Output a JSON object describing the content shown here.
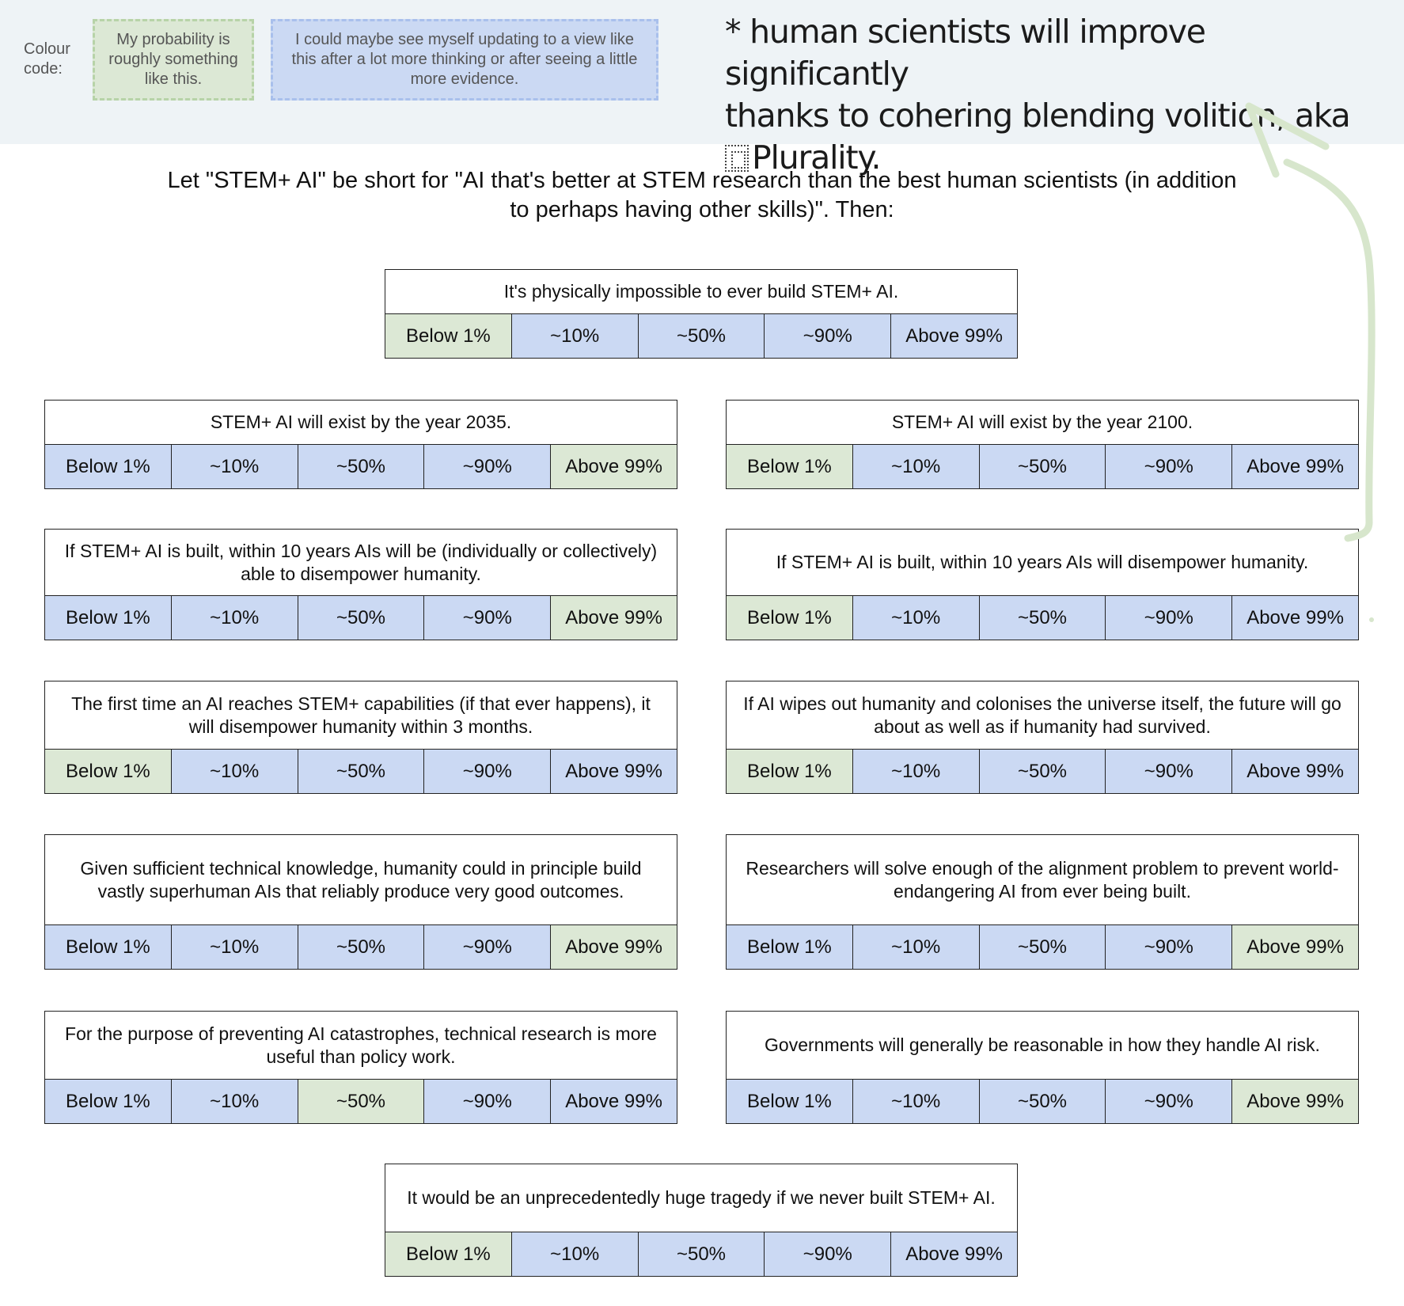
{
  "legend": {
    "label": "Colour code:",
    "green_text": "My probability is roughly something like this.",
    "blue_text": "I could maybe see myself updating to a view like this after a lot more thinking or after seeing a little more evidence.",
    "green_color": "#dce8d5",
    "blue_color": "#cbd9f3"
  },
  "annotation": {
    "line1": "* human scientists will improve significantly",
    "line2": "thanks to cohering blending volition, aka",
    "glyph": "copy-icon",
    "line3": "Plurality.",
    "arrow_color": "#d7e6cc"
  },
  "intro": "Let \"STEM+ AI\" be short for \"AI that's better at STEM research than the best human scientists (in addition to perhaps having other skills)\". Then:",
  "options": [
    "Below 1%",
    "~10%",
    "~50%",
    "~90%",
    "Above 99%"
  ],
  "questions": [
    {
      "text": "It's physically impossible to ever build STEM+ AI.",
      "selected": 0
    },
    {
      "text": "STEM+ AI will exist by the year 2035.",
      "selected": 4
    },
    {
      "text": "STEM+ AI will exist by the year 2100.",
      "selected": 0
    },
    {
      "text": "If STEM+ AI is built, within 10 years AIs will be (individually or collectively) able to disempower humanity.",
      "selected": 4
    },
    {
      "text": "If STEM+ AI is built, within 10 years AIs will disempower humanity.",
      "selected": 0
    },
    {
      "text": "The first time an AI reaches STEM+ capabilities (if that ever happens), it will disempower humanity within 3 months.",
      "selected": 0
    },
    {
      "text": "If AI wipes out humanity and colonises the universe itself, the future will go about as well as if humanity had survived.",
      "selected": 0
    },
    {
      "text": "Given sufficient technical knowledge, humanity could in principle build vastly superhuman AIs that reliably produce very good outcomes.",
      "selected": 4
    },
    {
      "text": "Researchers will solve enough of the alignment problem to prevent world-endangering AI from ever being built.",
      "selected": 4
    },
    {
      "text": "For the purpose of preventing AI catastrophes, technical research is more useful than policy work.",
      "selected": 2
    },
    {
      "text": "Governments will generally be reasonable in how they handle AI risk.",
      "selected": 4
    },
    {
      "text": "It would be an unprecedentedly huge tragedy if we never built STEM+ AI.",
      "selected": 0
    }
  ]
}
